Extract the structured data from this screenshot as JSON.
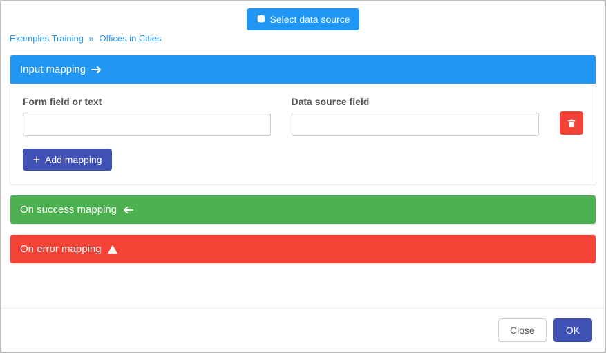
{
  "topButton": {
    "label": "Select data source"
  },
  "breadcrumb": {
    "root": "Examples Training",
    "current": "Offices in Cities"
  },
  "inputMapping": {
    "title": "Input mapping",
    "formFieldLabel": "Form field or text",
    "dataSourceFieldLabel": "Data source field",
    "formFieldValue": "",
    "dataSourceFieldValue": "",
    "addMappingLabel": "Add mapping"
  },
  "successMapping": {
    "title": "On success mapping"
  },
  "errorMapping": {
    "title": "On error mapping"
  },
  "footer": {
    "closeLabel": "Close",
    "okLabel": "OK"
  }
}
